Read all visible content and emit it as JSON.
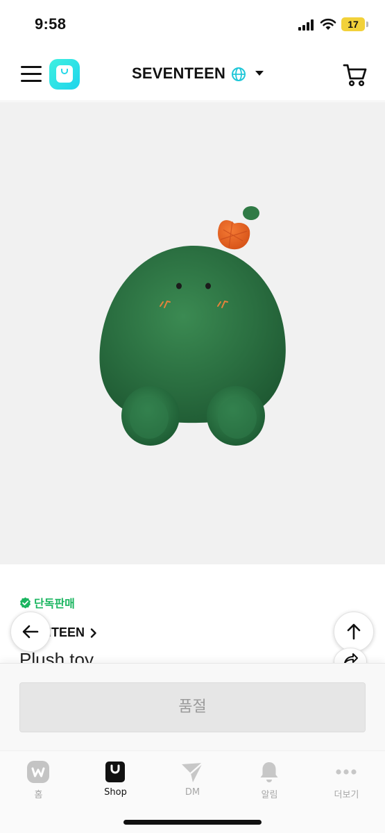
{
  "status_bar": {
    "time": "9:58",
    "battery": "17",
    "icons": [
      "signal-icon",
      "wifi-icon",
      "battery-icon"
    ]
  },
  "header": {
    "brand": "SEVENTEEN",
    "icons": [
      "menu-icon",
      "shop-logo-icon",
      "globe-icon",
      "chevron-down-icon",
      "cart-icon"
    ]
  },
  "product": {
    "exclusive_label": "단독판매",
    "artist_link": "NTEEN",
    "name": "Plush toy"
  },
  "actions": {
    "soldout_label": "품절"
  },
  "tab_bar": {
    "tabs": [
      {
        "label": "홈",
        "icon": "weverse-home-icon",
        "active": false
      },
      {
        "label": "Shop",
        "icon": "shop-icon",
        "active": true
      },
      {
        "label": "DM",
        "icon": "dm-send-icon",
        "active": false
      },
      {
        "label": "알림",
        "icon": "bell-icon",
        "active": false
      },
      {
        "label": "더보기",
        "icon": "more-dots-icon",
        "active": false
      }
    ]
  },
  "colors": {
    "accent": "#1fd4ec",
    "exclusive_green": "#1bb560",
    "soldout_bg": "#e6e6e6",
    "image_bg": "#f1f1f1"
  }
}
